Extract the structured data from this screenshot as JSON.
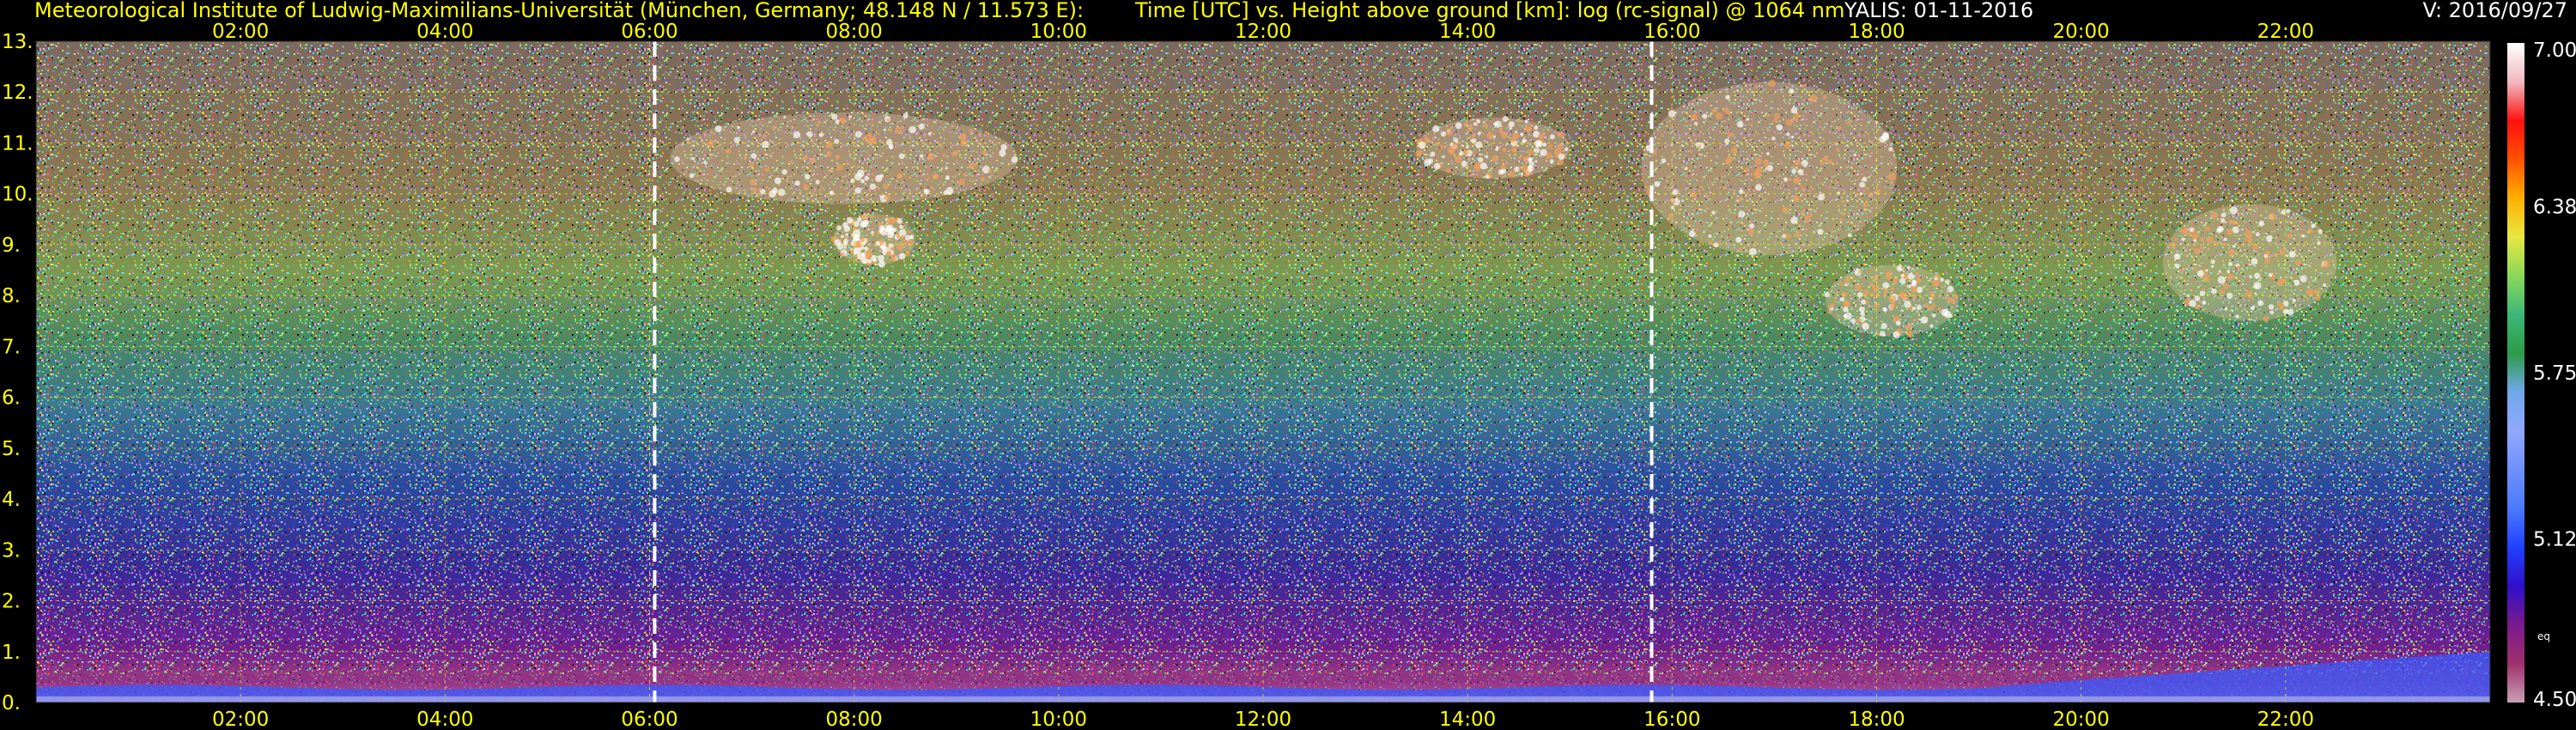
{
  "header": {
    "institution": "Meteorological Institute of Ludwig-Maximilians-Universität (München, Germany; 48.148 N / 11.573 E):",
    "description": "Time [UTC] vs. Height above ground [km]: log (rc-signal) @ 1064 nm",
    "system": "YALIS: 01-11-2016",
    "version": "V: 2016/09/27"
  },
  "chart_data": {
    "type": "heatmap",
    "title": "Time [UTC] vs. Height above ground [km]: log (rc-signal) @ 1064 nm",
    "x_ticks": [
      "02:00",
      "04:00",
      "06:00",
      "08:00",
      "10:00",
      "12:00",
      "14:00",
      "16:00",
      "18:00",
      "20:00",
      "22:00"
    ],
    "x_tick_hours": [
      2,
      4,
      6,
      8,
      10,
      12,
      14,
      16,
      18,
      20,
      22
    ],
    "xlim_hours": [
      0,
      24
    ],
    "y_ticks": [
      "0.",
      "1.",
      "2.",
      "3.",
      "4.",
      "5.",
      "6.",
      "7.",
      "8.",
      "9.",
      "10.",
      "11.",
      "12.",
      "13."
    ],
    "y_tick_km": [
      0,
      1,
      2,
      3,
      4,
      5,
      6,
      7,
      8,
      9,
      10,
      11,
      12,
      13
    ],
    "ylim_km": [
      0,
      13
    ],
    "grid": true,
    "grid_color": "#ffff00",
    "markers_hours": [
      6.05,
      15.8
    ],
    "marker_color": "#ffffff",
    "colorbar": {
      "ticks": [
        "7.00",
        "6.38",
        "5.75",
        "5.12",
        "4.50"
      ],
      "values": [
        7.0,
        6.38,
        5.75,
        5.12,
        4.5
      ],
      "range": [
        4.5,
        7.0
      ],
      "label": "eq",
      "colors": [
        "#c8a0b4",
        "#a0306e",
        "#7a1a8c",
        "#3010c8",
        "#2040ff",
        "#4a7aff",
        "#7090ff",
        "#90a8ff",
        "#6fa8e8",
        "#2f9a4a",
        "#3cb878",
        "#8ad85a",
        "#e8e840",
        "#ffb000",
        "#ff5000",
        "#ff1010",
        "#f0b8c0",
        "#ffffff"
      ]
    },
    "clouds": [
      {
        "t_start": 6.2,
        "t_end": 9.6,
        "h_bottom": 9.8,
        "h_top": 11.6
      },
      {
        "t_start": 7.8,
        "t_end": 8.6,
        "h_bottom": 8.6,
        "h_top": 9.6
      },
      {
        "t_start": 13.5,
        "t_end": 15.0,
        "h_bottom": 10.3,
        "h_top": 11.5
      },
      {
        "t_start": 15.7,
        "t_end": 18.2,
        "h_bottom": 8.8,
        "h_top": 12.2
      },
      {
        "t_start": 17.5,
        "t_end": 18.8,
        "h_bottom": 7.2,
        "h_top": 8.6
      },
      {
        "t_start": 20.8,
        "t_end": 22.5,
        "h_bottom": 7.5,
        "h_top": 9.8
      }
    ]
  }
}
